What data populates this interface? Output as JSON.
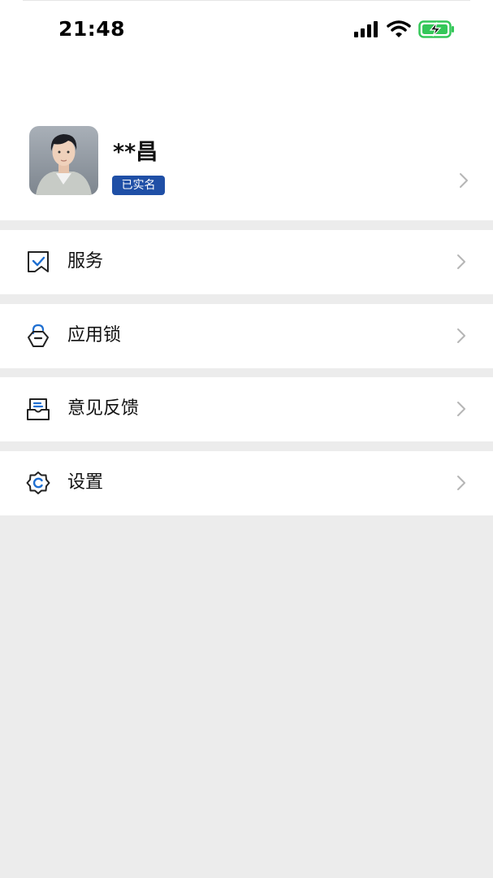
{
  "status_bar": {
    "time": "21:48",
    "icons": [
      "signal-icon",
      "wifi-icon",
      "battery-charging-icon"
    ]
  },
  "profile": {
    "name": "**昌",
    "badge": "已实名",
    "avatar": "avatar-photo"
  },
  "menu": [
    {
      "label": "服务",
      "icon": "service-icon"
    },
    {
      "label": "应用锁",
      "icon": "app-lock-icon"
    },
    {
      "label": "意见反馈",
      "icon": "feedback-icon"
    },
    {
      "label": "设置",
      "icon": "settings-icon"
    }
  ],
  "colors": {
    "badge_bg": "#1f4fa6",
    "page_bg": "#ececec",
    "card_bg": "#ffffff",
    "battery_green": "#34c759",
    "icon_blue": "#1f6fd1",
    "chevron": "#b5b5b5"
  }
}
